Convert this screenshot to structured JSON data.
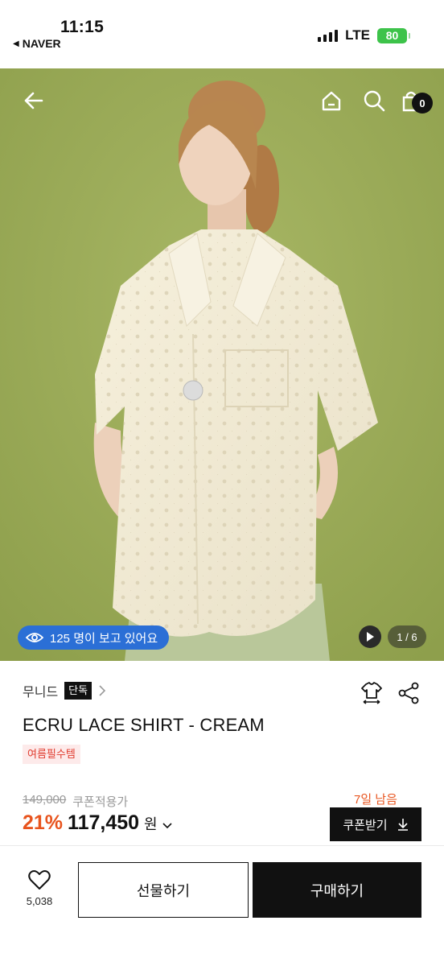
{
  "status_bar": {
    "time": "11:15",
    "back_app": "NAVER",
    "network": "LTE",
    "battery": "80"
  },
  "hero": {
    "cart_count": "0",
    "viewers_text": "125 명이 보고 있어요",
    "image_counter": "1 / 6",
    "colors": {
      "background": "#9cad5a",
      "shirt": "#f3ecd7",
      "viewers_pill": "#2b6fd6"
    },
    "icons": [
      "back-arrow-icon",
      "home-icon",
      "search-icon",
      "cart-icon",
      "eye-icon",
      "play-icon"
    ]
  },
  "product": {
    "brand": "무니드",
    "exclusive_badge": "단독",
    "title": "ECRU LACE SHIRT - CREAM",
    "tag": "여름필수템",
    "original_price": "149,000",
    "coupon_price_label": "쿠폰적용가",
    "discount": "21%",
    "final_price": "117,450",
    "currency": "원",
    "days_left": "7일 남음",
    "coupon_button": "쿠폰받기",
    "accent_color": "#e8541e"
  },
  "bottom_bar": {
    "like_count": "5,038",
    "gift_button": "선물하기",
    "buy_button": "구매하기"
  }
}
